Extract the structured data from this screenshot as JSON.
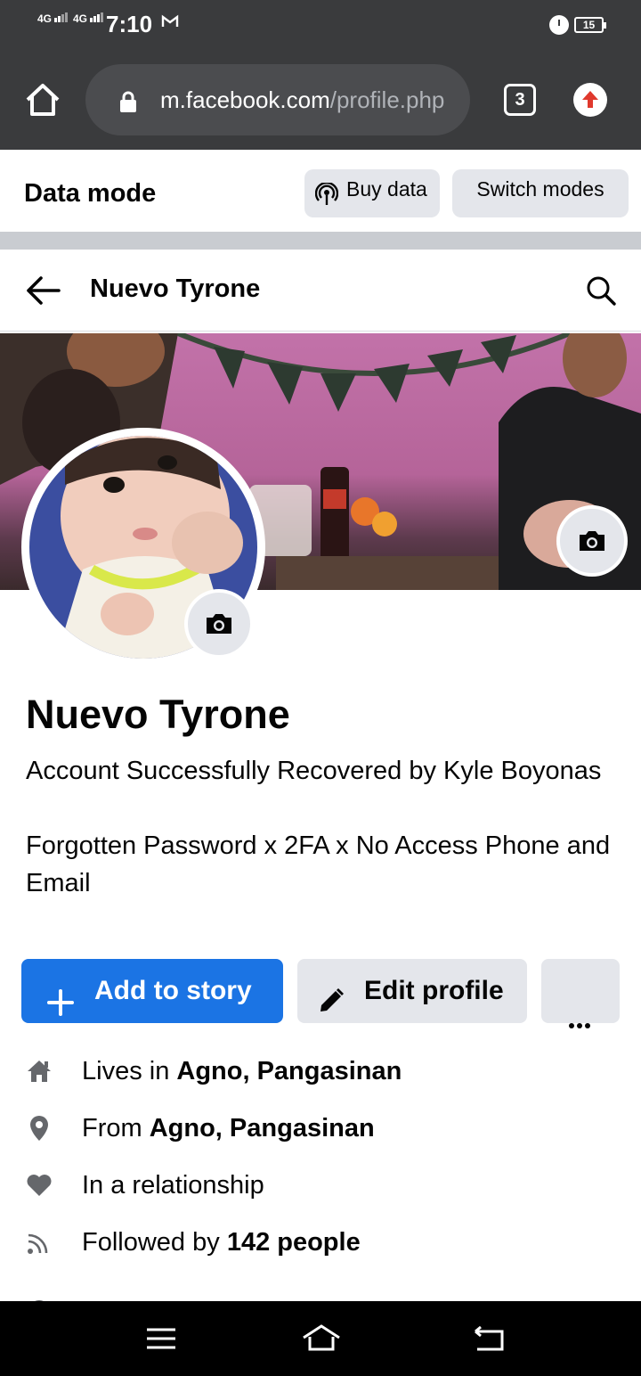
{
  "status_bar": {
    "signal_1": "4G",
    "signal_2": "4G",
    "time": "7:10",
    "notification_icon": "gmail-icon",
    "alarm_icon": "alarm-icon",
    "battery": "15"
  },
  "browser": {
    "url_domain": "m.facebook.com",
    "url_path": "/profile.php",
    "tab_count": "3"
  },
  "data_mode": {
    "title": "Data mode",
    "buy_data": "Buy data",
    "switch_modes": "Switch modes"
  },
  "header": {
    "title": "Nuevo Tyrone"
  },
  "profile": {
    "name": "Nuevo Tyrone",
    "bio_line_1": "Account Successfully Recovered by Kyle Boyonas",
    "bio_line_2": "Forgotten Password x 2FA x No Access Phone and Email"
  },
  "actions": {
    "add_story": "Add to story",
    "edit_profile": "Edit profile"
  },
  "details": {
    "lives_prefix": "Lives in ",
    "lives_value": "Agno, Pangasinan",
    "from_prefix": "From ",
    "from_value": "Agno, Pangasinan",
    "relationship": "In a relationship",
    "followed_prefix": "Followed by ",
    "followed_value": "142 people"
  },
  "colors": {
    "primary_blue": "#1b74e4",
    "chrome_dark": "#3a3b3d",
    "button_gray": "#e4e6eb",
    "update_red": "#e0392d"
  }
}
